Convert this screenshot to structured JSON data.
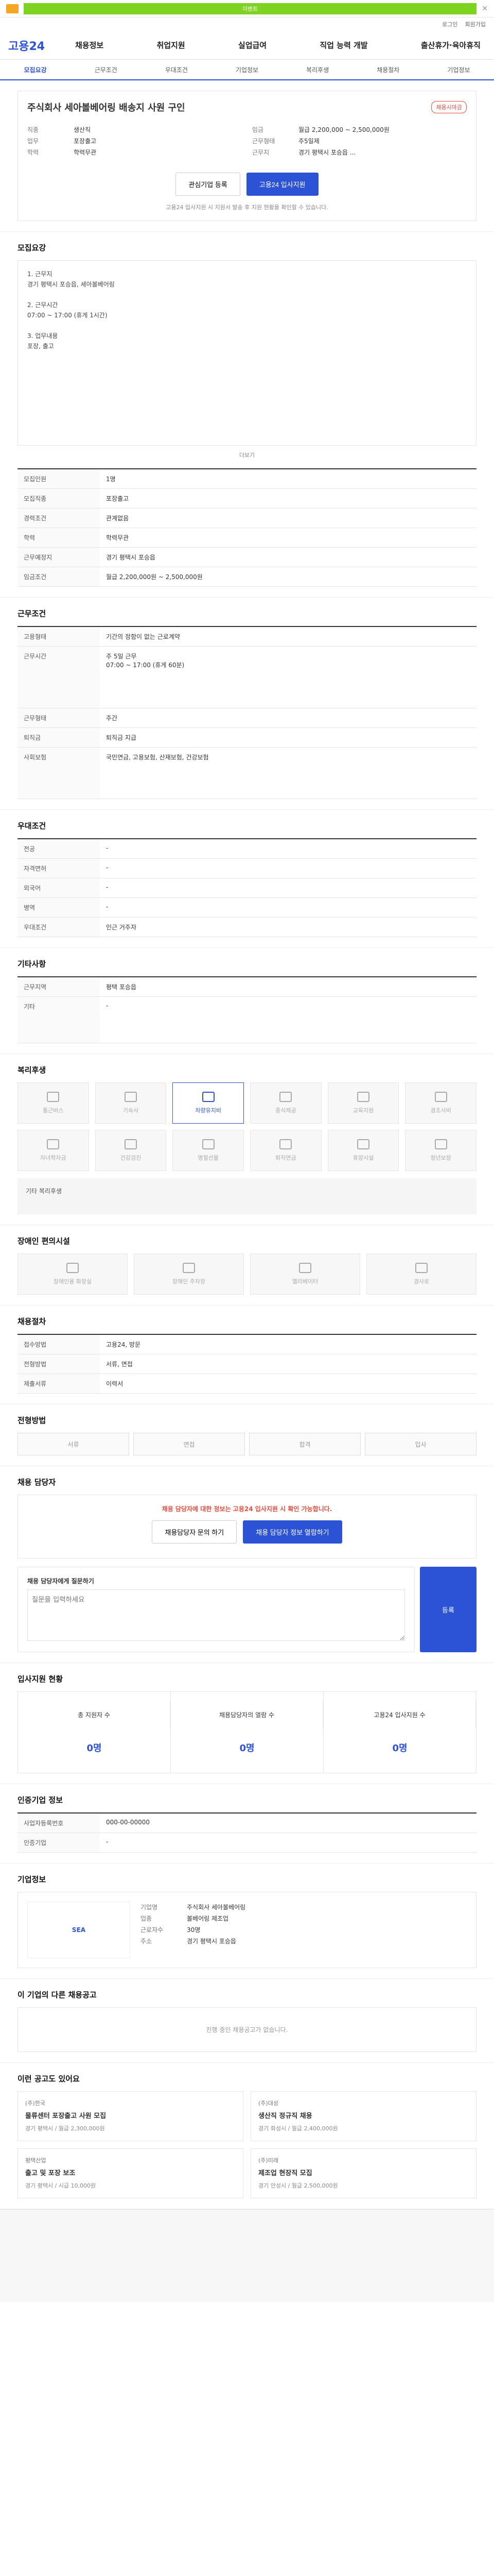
{
  "topbar": {
    "banner": "이벤트"
  },
  "util": [
    "로그인",
    "회원가입"
  ],
  "logo": "고용24",
  "gnb": [
    "채용정보",
    "취업지원",
    "실업급여",
    "직업 능력 개발",
    "출산휴가·육아휴직"
  ],
  "tabs": [
    "모집요강",
    "근무조건",
    "우대조건",
    "기업정보",
    "복리후생",
    "채용절차",
    "기업정보"
  ],
  "company": {
    "title": "주식회사 세아볼베어링 배송지 사원 구인",
    "tag": "채용시마감",
    "left": [
      {
        "k": "직종",
        "v": "생산직"
      },
      {
        "k": "업무",
        "v": "포장출고"
      },
      {
        "k": "학력",
        "v": "학력무관"
      }
    ],
    "right": [
      {
        "k": "임금",
        "v": "월급 2,200,000 ~ 2,500,000원"
      },
      {
        "k": "근무형태",
        "v": "주5일제"
      },
      {
        "k": "근무지",
        "v": "경기 평택시 포승읍 ..."
      }
    ]
  },
  "buttons": {
    "interest": "관심기업 등록",
    "apply": "고용24 입사지원"
  },
  "notice": "고용24 입사지원 시 지원서 발송 후 지원 현황을 확인할 수 있습니다.",
  "recruit": {
    "title": "모집요강",
    "body": "1. 근무지\n경기 평택시 포승읍, 세아볼베어링\n\n2. 근무시간\n07:00 ~ 17:00 (휴게 1시간)\n\n3. 업무내용\n포장, 출고",
    "more": "더보기"
  },
  "sec": {
    "cond": "근무조건",
    "pref": "우대조건",
    "etc": "기타사항",
    "welfare": "복리후생",
    "disabled": "장애인 편의시설",
    "process": "채용절차",
    "apply": "전형방법",
    "person": "채용 담당자",
    "stat": "입사지원 현황",
    "detail": "인증기업 정보",
    "corp": "기업정보",
    "more_jobs": "이 기업의 다른 채용공고",
    "rec": "이런 공고도 있어요"
  },
  "info_rows": [
    {
      "k": "모집인원",
      "v": "1명"
    },
    {
      "k": "모집직종",
      "v": "포장출고"
    },
    {
      "k": "경력조건",
      "v": "관계없음"
    },
    {
      "k": "학력",
      "v": "학력무관"
    },
    {
      "k": "근무예정지",
      "v": "경기 평택시 포승읍"
    },
    {
      "k": "임금조건",
      "v": "월급 2,200,000원 ~ 2,500,000원"
    }
  ],
  "cond_rows": [
    {
      "k": "고용형태",
      "v": "기간의 정함이 없는 근로계약"
    },
    {
      "k": "근무시간",
      "v": "주 5일 근무\n07:00 ~ 17:00 (휴게 60분)"
    },
    {
      "k": "근무형태",
      "v": "주간"
    },
    {
      "k": "퇴직금",
      "v": "퇴직금 지급"
    },
    {
      "k": "사회보험",
      "v": "국민연금, 고용보험, 산재보험, 건강보험"
    }
  ],
  "pref_rows": [
    {
      "k": "전공",
      "v": "-"
    },
    {
      "k": "자격면허",
      "v": "-"
    },
    {
      "k": "외국어",
      "v": "-"
    },
    {
      "k": "병역",
      "v": "-"
    },
    {
      "k": "우대조건",
      "v": "인근 거주자"
    }
  ],
  "etc_rows": [
    {
      "k": "근무지역",
      "v": "평택 포승읍"
    },
    {
      "k": "기타",
      "v": "-"
    }
  ],
  "welfare": [
    "통근버스",
    "기숙사",
    "차량유지비",
    "중식제공",
    "교육지원",
    "경조사비",
    "자녀학자금",
    "건강검진",
    "명절선물",
    "퇴직연금",
    "휴양시설",
    "정년보장"
  ],
  "welfare_note": "기타 복리후생",
  "disabled": [
    "장애인용 화장실",
    "장애인 주차장",
    "엘리베이터",
    "경사로"
  ],
  "process": [
    {
      "k": "접수방법",
      "v": "고용24, 방문"
    },
    {
      "k": "전형방법",
      "v": "서류, 면접"
    },
    {
      "k": "제출서류",
      "v": "이력서"
    }
  ],
  "apply_steps": [
    "서류",
    "면접",
    "합격",
    "입사"
  ],
  "person_notice": "채용 담당자에 대한 정보는 고용24 입사지원 시 확인 가능합니다.",
  "person_buttons": [
    "채용담당자 문의 하기",
    "채용 담당자 정보 열람하기"
  ],
  "ask": {
    "label": "채용 담당자에게 질문하기",
    "placeholder": "질문을 입력하세요",
    "btn": "등록"
  },
  "stats": [
    {
      "t": "총 지원자 수",
      "n": "0명"
    },
    {
      "t": "채용담당자의 열람 수",
      "n": "0명"
    },
    {
      "t": "고용24 입사지원 수",
      "n": "0명"
    }
  ],
  "detail_rows": [
    {
      "k": "사업자등록번호",
      "v": "000-00-00000"
    },
    {
      "k": "인증기업",
      "v": "-"
    }
  ],
  "corp_rows": [
    {
      "k": "기업명",
      "v": "주식회사 세아볼베어링"
    },
    {
      "k": "업종",
      "v": "볼베어링 제조업"
    },
    {
      "k": "근로자수",
      "v": "30명"
    },
    {
      "k": "주소",
      "v": "경기 평택시 포승읍"
    }
  ],
  "more_jobs_empty": "진행 중인 채용공고가 없습니다.",
  "rec": [
    {
      "c": "(주)한국",
      "t": "물류센터 포장출고 사원 모집",
      "m": "경기 평택시 / 월급 2,300,000원"
    },
    {
      "c": "(주)대성",
      "t": "생산직 정규직 채용",
      "m": "경기 화성시 / 월급 2,400,000원"
    },
    {
      "c": "평택산업",
      "t": "출고 및 포장 보조",
      "m": "경기 평택시 / 시급 10,000원"
    },
    {
      "c": "(주)미래",
      "t": "제조업 현장직 모집",
      "m": "경기 안성시 / 월급 2,500,000원"
    }
  ]
}
